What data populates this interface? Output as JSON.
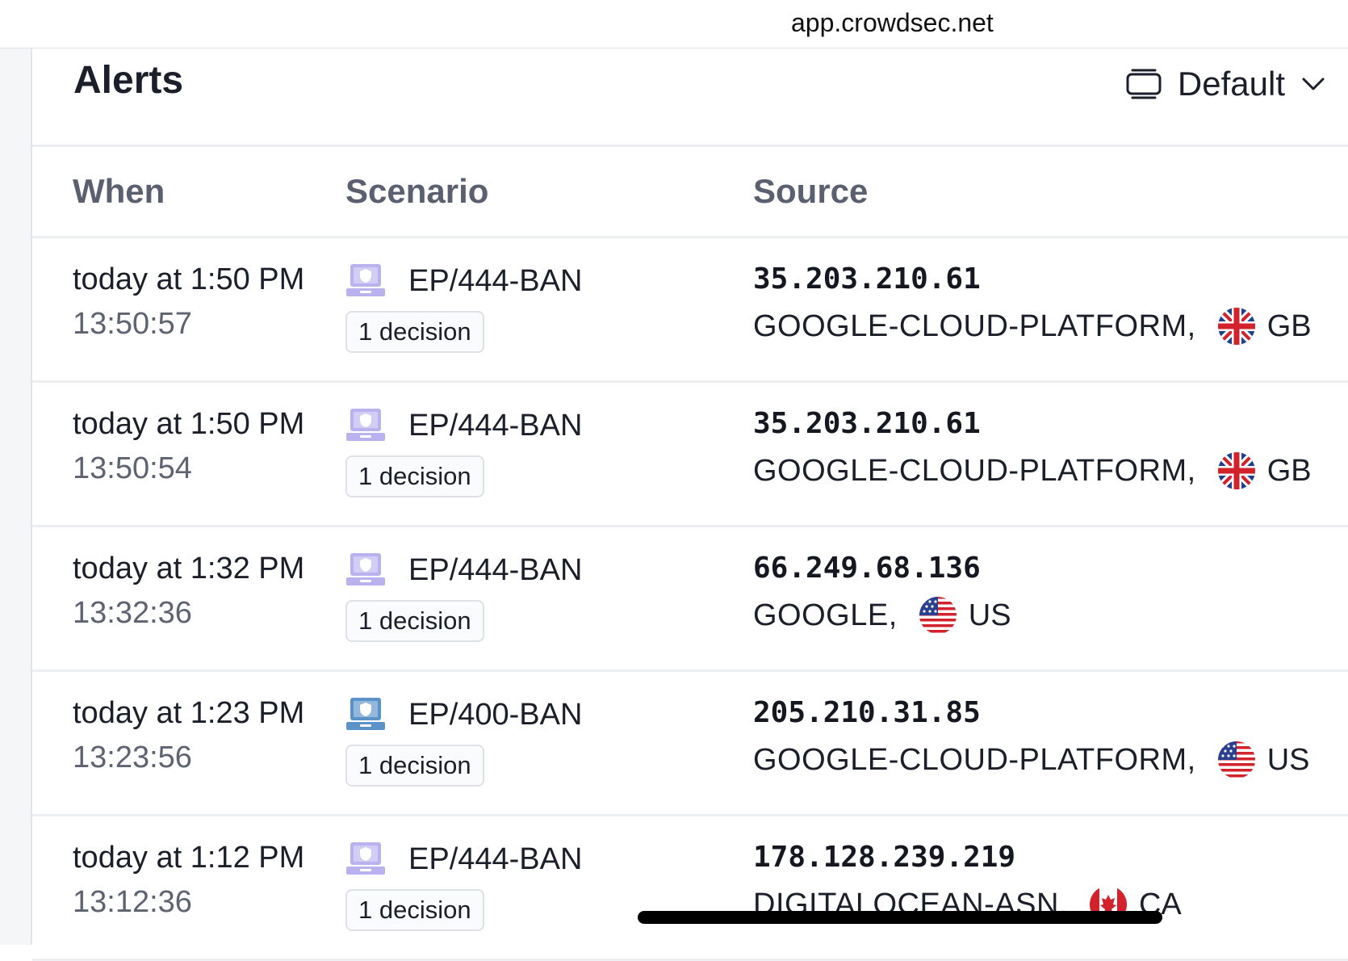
{
  "browser": {
    "url": "app.crowdsec.net"
  },
  "page": {
    "title": "Alerts",
    "view_selector": {
      "label": "Default",
      "icon": "stack-icon",
      "caret": "chevron-down-icon"
    }
  },
  "table": {
    "columns": [
      "When",
      "Scenario",
      "Source"
    ],
    "rows": [
      {
        "when": "today at 1:50 PM",
        "time": "13:50:57",
        "scenario": "EP/444-BAN",
        "scenario_icon": "laptop-shield-icon",
        "scenario_color": "#b9b2ee",
        "decisions": "1 decision",
        "ip": "35.203.210.61",
        "asn": "GOOGLE-CLOUD-PLATFORM,",
        "country": "GB",
        "flag": "gb"
      },
      {
        "when": "today at 1:50 PM",
        "time": "13:50:54",
        "scenario": "EP/444-BAN",
        "scenario_icon": "laptop-shield-icon",
        "scenario_color": "#b9b2ee",
        "decisions": "1 decision",
        "ip": "35.203.210.61",
        "asn": "GOOGLE-CLOUD-PLATFORM,",
        "country": "GB",
        "flag": "gb"
      },
      {
        "when": "today at 1:32 PM",
        "time": "13:32:36",
        "scenario": "EP/444-BAN",
        "scenario_icon": "laptop-shield-icon",
        "scenario_color": "#b9b2ee",
        "decisions": "1 decision",
        "ip": "66.249.68.136",
        "asn": "GOOGLE,",
        "country": "US",
        "flag": "us"
      },
      {
        "when": "today at 1:23 PM",
        "time": "13:23:56",
        "scenario": "EP/400-BAN",
        "scenario_icon": "laptop-shield-icon",
        "scenario_color": "#5b93c8",
        "decisions": "1 decision",
        "ip": "205.210.31.85",
        "asn": "GOOGLE-CLOUD-PLATFORM,",
        "country": "US",
        "flag": "us"
      },
      {
        "when": "today at 1:12 PM",
        "time": "13:12:36",
        "scenario": "EP/444-BAN",
        "scenario_icon": "laptop-shield-icon",
        "scenario_color": "#b9b2ee",
        "decisions": "1 decision",
        "ip": "178.128.239.219",
        "asn": "DIGITALOCEAN-ASN,",
        "country": "CA",
        "flag": "ca"
      }
    ]
  }
}
